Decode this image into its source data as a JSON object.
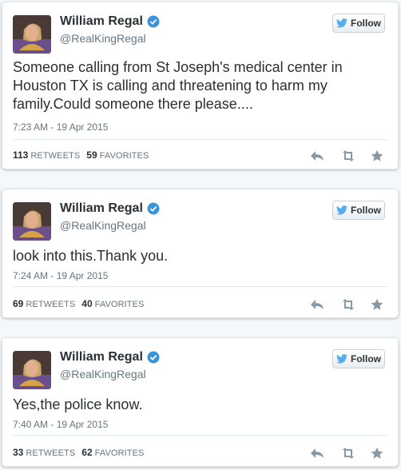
{
  "tweets": [
    {
      "display_name": "William Regal",
      "handle": "@RealKingRegal",
      "follow_label": "Follow",
      "text": "Someone calling from St Joseph's medical center in Houston TX is calling and threatening to harm my family.Could someone there please....",
      "timestamp": "7:23 AM - 19 Apr 2015",
      "retweets": "113",
      "retweets_label": "RETWEETS",
      "favorites": "59",
      "favorites_label": "FAVORITES"
    },
    {
      "display_name": "William Regal",
      "handle": "@RealKingRegal",
      "follow_label": "Follow",
      "text": "look into this.Thank you.",
      "timestamp": "7:24 AM - 19 Apr 2015",
      "retweets": "69",
      "retweets_label": "RETWEETS",
      "favorites": "40",
      "favorites_label": "FAVORITES"
    },
    {
      "display_name": "William Regal",
      "handle": "@RealKingRegal",
      "follow_label": "Follow",
      "text": "Yes,the police know.",
      "timestamp": "7:40 AM - 19 Apr 2015",
      "retweets": "33",
      "retweets_label": "RETWEETS",
      "favorites": "62",
      "favorites_label": "FAVORITES"
    }
  ],
  "colors": {
    "twitter_blue": "#55acee",
    "verified_blue": "#3b94d9",
    "icon_gray": "#8899a6"
  },
  "icons": [
    "verified-badge-icon",
    "twitter-bird-icon",
    "reply-icon",
    "retweet-icon",
    "favorite-star-icon"
  ]
}
